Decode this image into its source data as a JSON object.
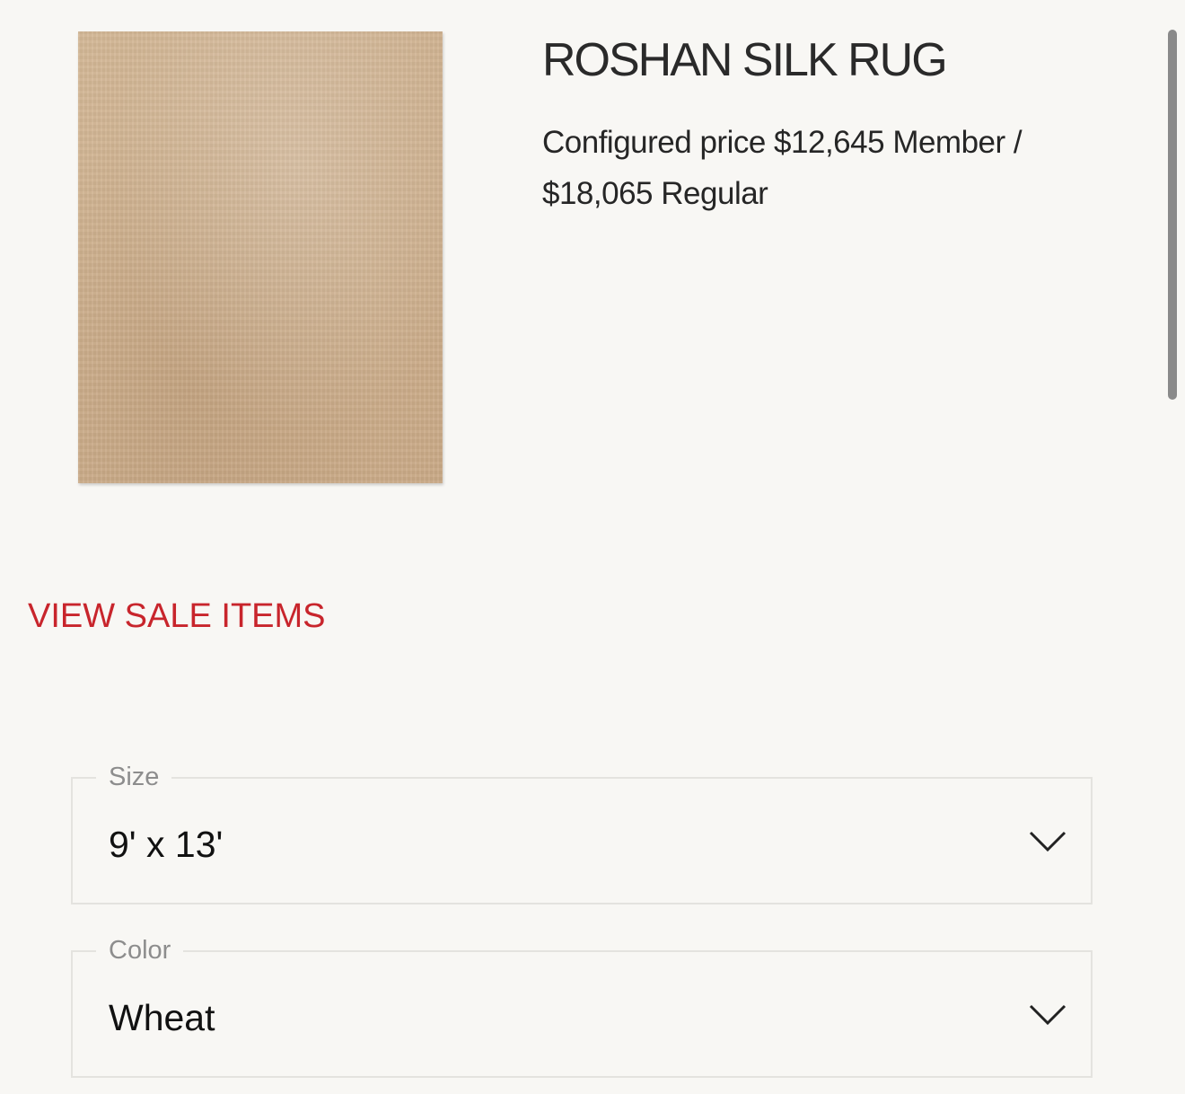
{
  "product": {
    "image_icon": "rug-image",
    "title": "ROSHAN SILK RUG",
    "price_prefix": "Configured price",
    "member_price": "$12,645",
    "member_label": "Member /",
    "regular_price": "$18,065",
    "regular_label": "Regular"
  },
  "sale_link": {
    "label": "VIEW SALE ITEMS",
    "color": "#c8252c"
  },
  "options": {
    "size": {
      "label": "Size",
      "value": "9' x 13'",
      "icon": "chevron-down-icon"
    },
    "color": {
      "label": "Color",
      "value": "Wheat",
      "icon": "chevron-down-icon"
    }
  }
}
